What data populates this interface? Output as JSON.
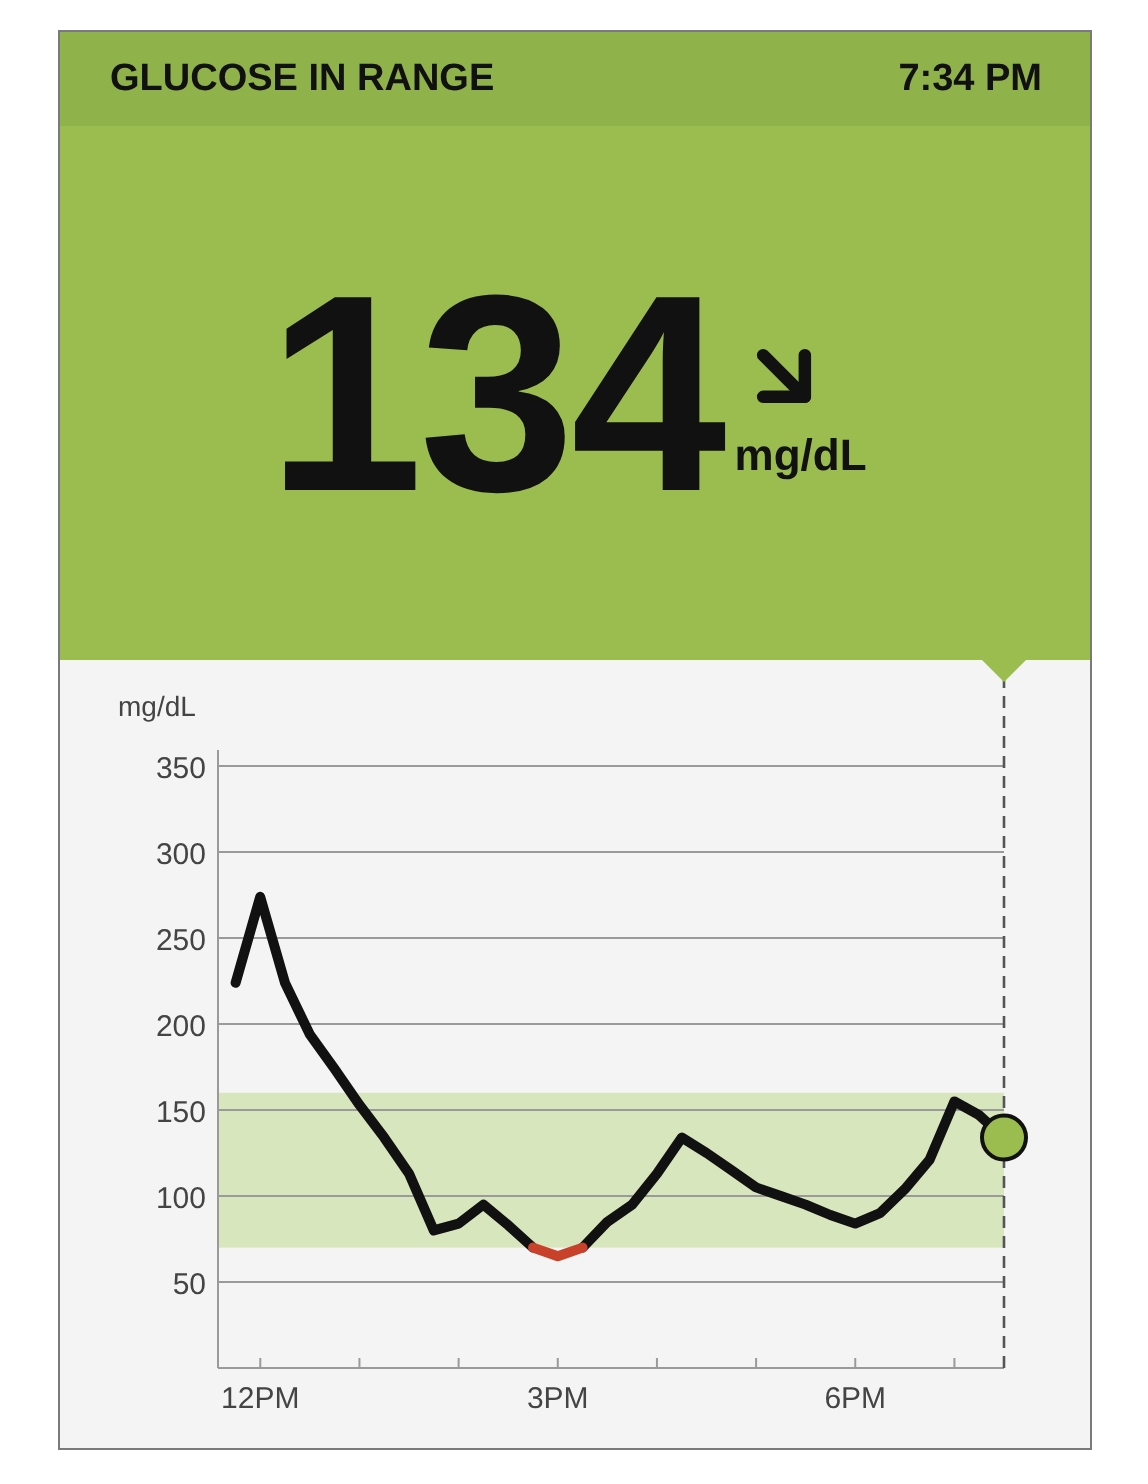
{
  "header": {
    "status": "GLUCOSE IN RANGE",
    "time": "7:34 PM"
  },
  "reading": {
    "value": "134",
    "unit": "mg/dL"
  },
  "chart": {
    "chart_data": {
      "type": "line",
      "ylabel": "mg/dL",
      "grid": true,
      "categories": [
        null,
        "12PM",
        null,
        null,
        null,
        null,
        null,
        null,
        null,
        null,
        null,
        null,
        null,
        "3PM",
        null,
        null,
        null,
        null,
        null,
        null,
        null,
        null,
        null,
        null,
        null,
        "6PM",
        null,
        null,
        null,
        null,
        null,
        null
      ],
      "series": [
        {
          "color": "#111111",
          "values": [
            224,
            274,
            224,
            194,
            174,
            153,
            134,
            113,
            80,
            84,
            95,
            83,
            70,
            null,
            70,
            85,
            95,
            113,
            134,
            125,
            115,
            105,
            100,
            95,
            89,
            84,
            90,
            104,
            121,
            155,
            147,
            134
          ]
        },
        {
          "color": "#c8412a",
          "values": [
            null,
            null,
            null,
            null,
            null,
            null,
            null,
            null,
            null,
            null,
            null,
            null,
            70,
            65,
            70,
            null,
            null,
            null,
            null,
            null,
            null,
            null,
            null,
            null,
            null,
            null,
            null,
            null,
            null,
            null,
            null,
            null
          ]
        }
      ],
      "ylim": [
        0,
        350
      ],
      "yticks": [
        50,
        100,
        150,
        200,
        250,
        300,
        350
      ],
      "bands": [
        {
          "axis": "y",
          "from": 70,
          "to": 160,
          "color": "#d8e6bd"
        }
      ]
    }
  }
}
